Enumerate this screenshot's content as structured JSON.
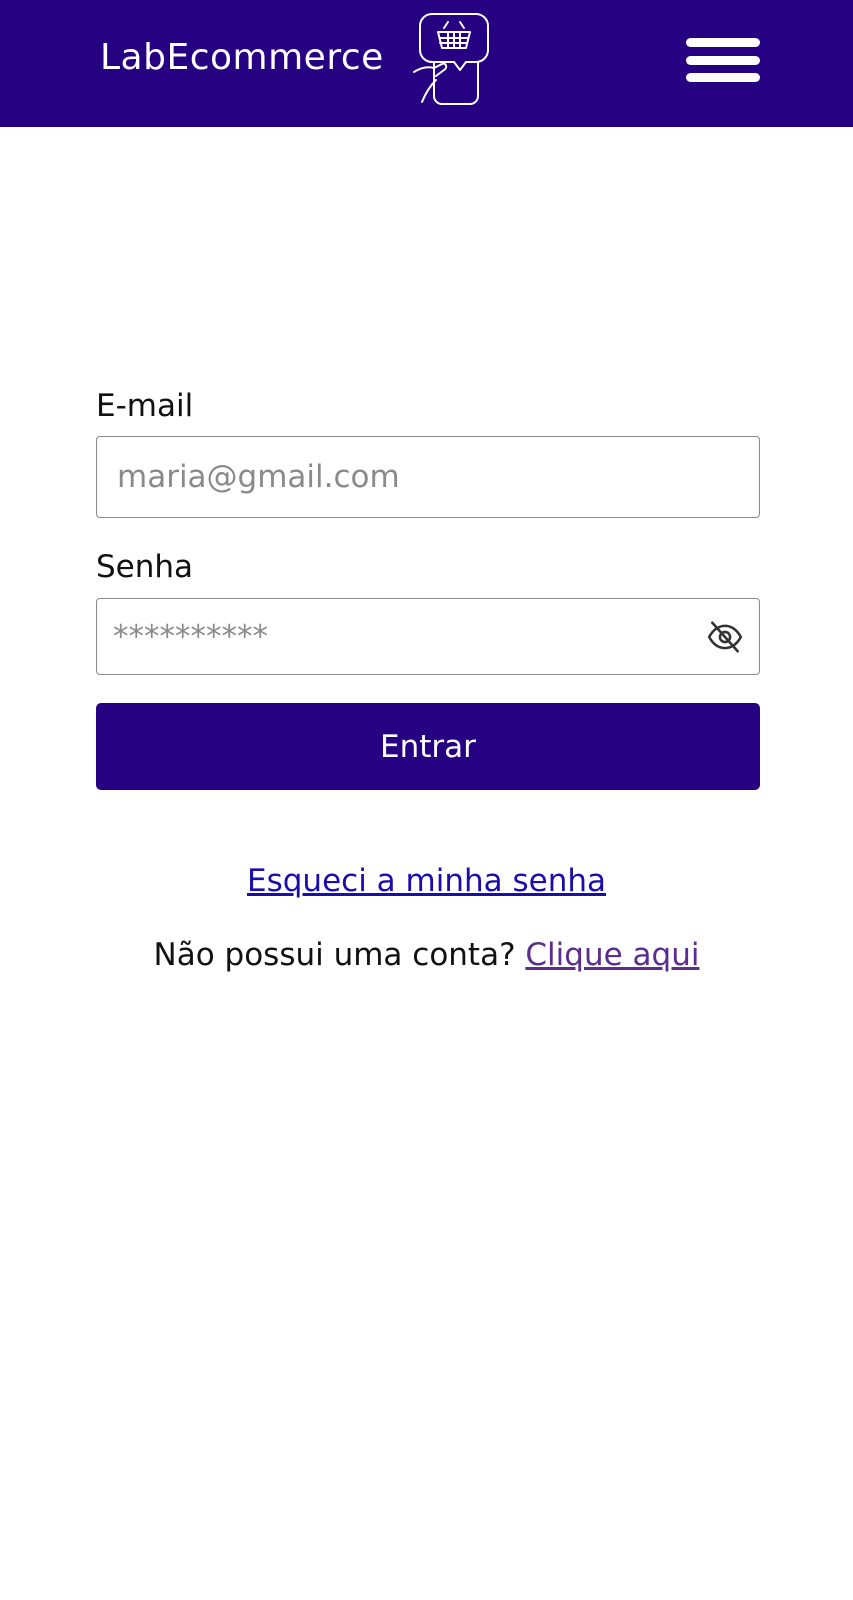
{
  "header": {
    "brand": "LabEcommerce",
    "logo_icon": "phone-basket-icon",
    "menu_icon": "hamburger-menu-icon",
    "color": "#260181"
  },
  "form": {
    "email_label": "E-mail",
    "email_placeholder": "maria@gmail.com",
    "email_value": "",
    "password_label": "Senha",
    "password_placeholder": "**********",
    "password_toggle_icon": "eye-off-icon",
    "submit_label": "Entrar",
    "submit_color": "#260181"
  },
  "links": {
    "forgot_password": "Esqueci a minha senha",
    "signup_prompt": "Não possui uma conta?",
    "signup_link": "Clique aqui"
  }
}
